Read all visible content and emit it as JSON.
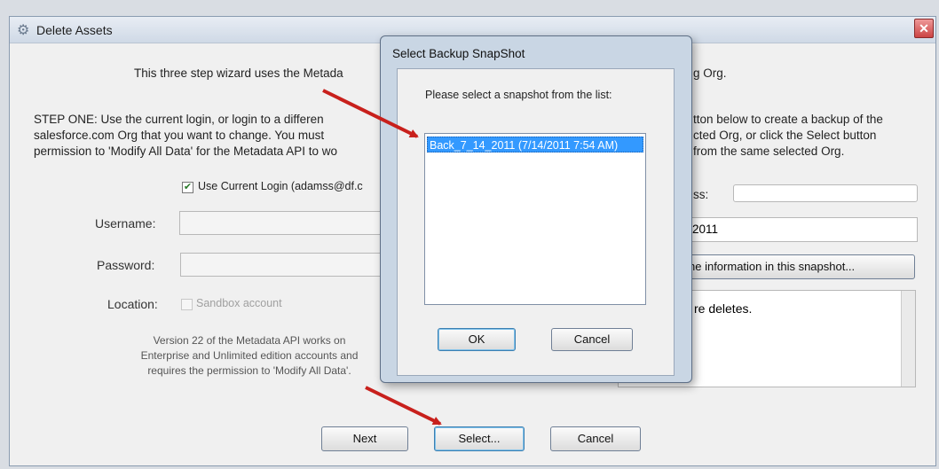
{
  "window": {
    "title": "Delete Assets",
    "close_glyph": "✕"
  },
  "intro": {
    "left": "This three step wizard uses the Metada",
    "right": "g Org."
  },
  "step_one": {
    "line1": "STEP ONE: Use the current login, or login to a differen",
    "line2": "salesforce.com Org that you want to change. You must",
    "line3": "permission to 'Modify All Data' for the Metadata API to wo"
  },
  "step_two": {
    "line1": "tton below to create a backup of the",
    "line2": "cted Org, or click the Select button",
    "line3": "from the same selected Org."
  },
  "login": {
    "use_current_label": "Use Current Login (adamss@df.c",
    "use_current_checked": true,
    "username_label": "Username:",
    "username_value": "",
    "password_label": "Password:",
    "password_value": "",
    "location_label": "Location:",
    "sandbox_label": "Sandbox account",
    "sandbox_checked": false,
    "version_note": [
      "Version 22 of the Metadata API works on",
      "Enterprise and Unlimited edition accounts and",
      "requires the permission to 'Modify All Data'."
    ]
  },
  "backup": {
    "address_label": "ss:",
    "address_value": "",
    "date_value": "2011",
    "info_button": "he information in this snapshot...",
    "notes_text": "re deletes."
  },
  "footer": {
    "next": "Next",
    "select": "Select...",
    "cancel": "Cancel"
  },
  "dialog": {
    "title": "Select Backup SnapShot",
    "prompt": "Please select a snapshot from the list:",
    "items": [
      "Back_7_14_2011 (7/14/2011 7:54 AM)"
    ],
    "ok": "OK",
    "cancel": "Cancel"
  },
  "colors": {
    "arrow": "#c8201c",
    "selection": "#3399ff"
  },
  "icons": {
    "title_icon": "gear-icon",
    "check": "checkmark-icon"
  }
}
